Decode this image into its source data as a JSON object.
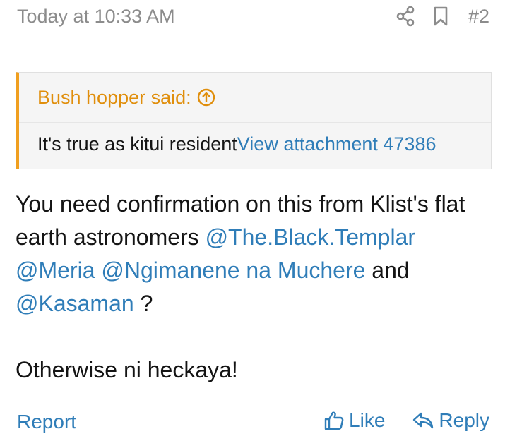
{
  "header": {
    "timestamp": "Today at 10:33 AM",
    "post_number": "#2",
    "share_icon": "share-icon",
    "bookmark_icon": "bookmark-icon"
  },
  "quote": {
    "author_said": "Bush hopper said:",
    "jump_icon": "arrow-up-circle-icon",
    "text": "It's true as kitui resident",
    "attachment_link": "View attachment 47386"
  },
  "message": {
    "line1": "You need confirmation on this from Klist's flat earth astronomers ",
    "mention1": "@The.Black.Templar",
    "mention2": "@Meria",
    "mention3": "@Ngimanene na Muchere",
    "and": " and ",
    "mention4": "@Kasaman",
    "question": " ?",
    "paragraph2": "Otherwise ni heckaya!"
  },
  "footer": {
    "report": "Report",
    "like": "Like",
    "reply": "Reply",
    "like_icon": "thumbs-up-icon",
    "reply_icon": "reply-icon"
  },
  "colors": {
    "link": "#2f7db8",
    "quote_accent": "#f09f1f",
    "muted": "#8c8c8c"
  }
}
